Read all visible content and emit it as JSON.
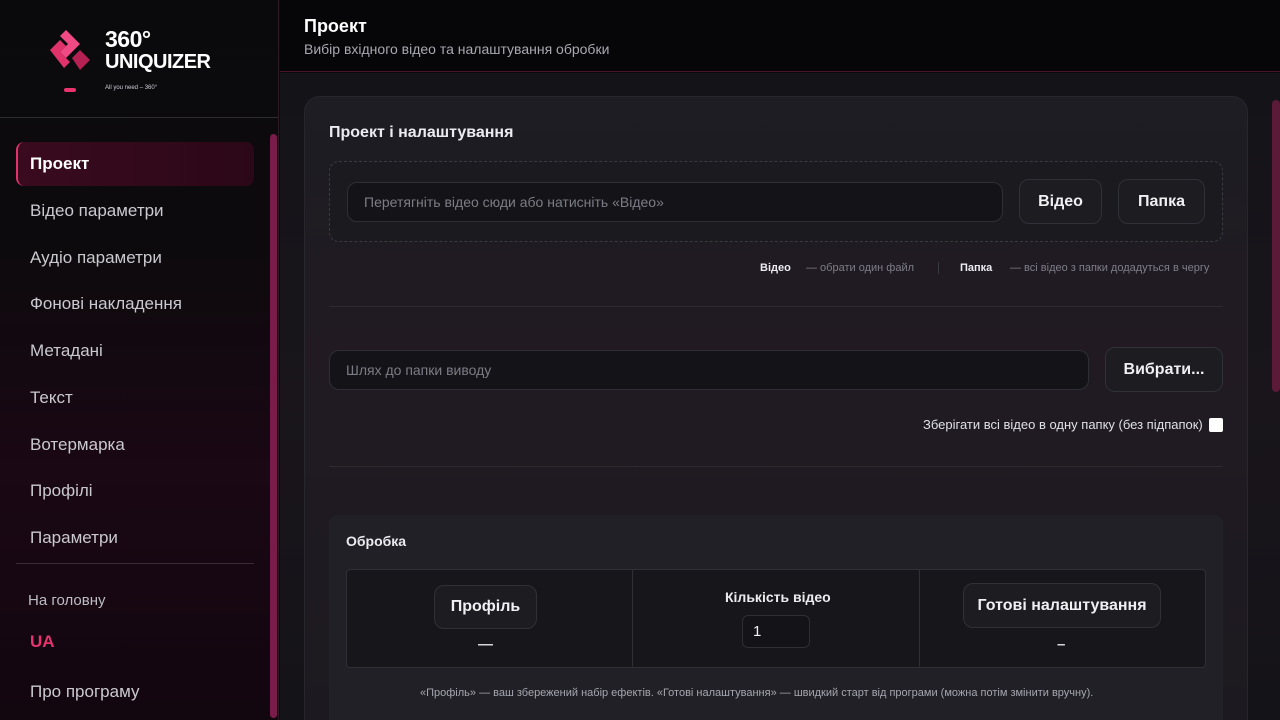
{
  "brand": {
    "logo_top": "360°",
    "logo_name": "UNIQUIZER",
    "tagline": "All you need – 360°",
    "accent": "#e8336e"
  },
  "sidebar": {
    "items": [
      {
        "label": "Проект",
        "active": true
      },
      {
        "label": "Відео параметри"
      },
      {
        "label": "Аудіо параметри"
      },
      {
        "label": "Фонові накладення"
      },
      {
        "label": "Метадані"
      },
      {
        "label": "Текст"
      },
      {
        "label": "Вотермарка"
      },
      {
        "label": "Профілі"
      },
      {
        "label": "Параметри"
      }
    ],
    "home": "На головну",
    "lang": "UA",
    "about": "Про програму"
  },
  "header": {
    "title": "Проект",
    "subtitle": "Вибір вхідного відео та налаштування обробки"
  },
  "card": {
    "title": "Проект і налаштування",
    "drop_placeholder": "Перетягніть відео сюди або натисніть «Відео»",
    "video_button": "Відео",
    "folder_button": "Папка",
    "hint_video_key": "Відео",
    "hint_video_text": "— обрати один файл",
    "hint_folder_key": "Папка",
    "hint_folder_text": "— всі відео з папки додадуться в чергу",
    "output_placeholder": "Шлях до папки виводу",
    "choose_button": "Вибрати...",
    "single_folder_label": "Зберігати всі відео в одну папку (без підпапок)",
    "single_folder_checked": false
  },
  "processing": {
    "title": "Обробка",
    "profile_button": "Профіль",
    "profile_value": "—",
    "count_label": "Кількість відео",
    "count_value": "1",
    "presets_button": "Готові налаштування",
    "presets_value": "–",
    "note": "«Профіль» — ваш збережений набір ефектів. «Готові налаштування» — швидкий старт від програми (можна потім змінити вручну)."
  }
}
